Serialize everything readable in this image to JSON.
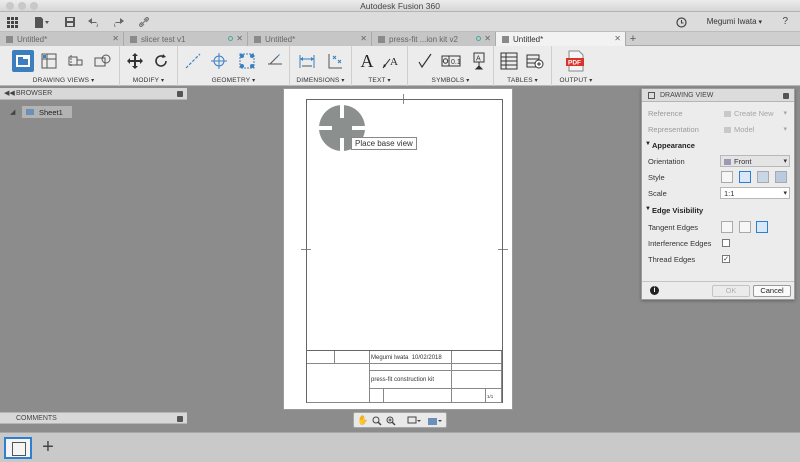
{
  "window": {
    "title": "Autodesk Fusion 360"
  },
  "user": {
    "name": "Megumi Iwata"
  },
  "tabs": [
    {
      "label": "Untitled*",
      "active": false
    },
    {
      "label": "slicer test v1",
      "active": false
    },
    {
      "label": "Untitled*",
      "active": false
    },
    {
      "label": "press-fit ...ion kit v2",
      "active": false
    },
    {
      "label": "Untitled*",
      "active": true
    }
  ],
  "ribbon": {
    "groups": [
      {
        "label": "DRAWING VIEWS"
      },
      {
        "label": "MODIFY"
      },
      {
        "label": "GEOMETRY"
      },
      {
        "label": "DIMENSIONS"
      },
      {
        "label": "TEXT"
      },
      {
        "label": "SYMBOLS"
      },
      {
        "label": "TABLES"
      },
      {
        "label": "OUTPUT"
      }
    ],
    "text_glyph": "A",
    "pdf_glyph": "PDF"
  },
  "browser": {
    "title": "BROWSER",
    "sheet": "Sheet1"
  },
  "comments": {
    "title": "COMMENTS"
  },
  "canvas": {
    "tooltip": "Place base view"
  },
  "titleblock": {
    "drawn_by": "Megumi Iwata",
    "date": "10/02/2018",
    "title": "press-fit construction kit",
    "sheet": "1/1"
  },
  "drawing_view": {
    "title": "DRAWING VIEW",
    "reference_label": "Reference",
    "reference_value": "Create New",
    "representation_label": "Representation",
    "representation_value": "Model",
    "appearance_section": "Appearance",
    "orientation_label": "Orientation",
    "orientation_value": "Front",
    "style_label": "Style",
    "scale_label": "Scale",
    "scale_value": "1:1",
    "edge_section": "Edge Visibility",
    "tangent_label": "Tangent Edges",
    "interference_label": "Interference Edges",
    "interference_checked": false,
    "thread_label": "Thread Edges",
    "thread_checked": true,
    "ok_label": "OK",
    "cancel_label": "Cancel"
  },
  "colors": {
    "accent": "#2e7fd0",
    "workspace": "#8c8c8c",
    "base_view": "#8b8f8e"
  }
}
